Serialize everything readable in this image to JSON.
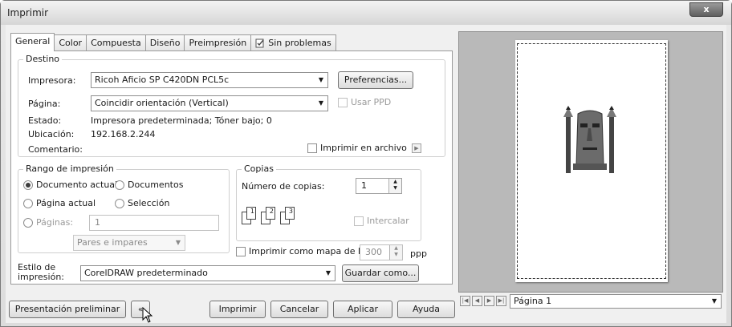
{
  "window": {
    "title": "Imprimir",
    "close_label": "x"
  },
  "tabs": [
    {
      "label": "General",
      "active": true
    },
    {
      "label": "Color"
    },
    {
      "label": "Compuesta"
    },
    {
      "label": "Diseño"
    },
    {
      "label": "Preimpresión"
    },
    {
      "label": "Sin problemas",
      "icon": "check-document-icon"
    }
  ],
  "destino": {
    "title": "Destino",
    "printer_label": "Impresora:",
    "printer_value": "Ricoh Aficio SP C420DN PCL5c",
    "preferences_button": "Preferencias...",
    "page_label": "Página:",
    "page_value": "Coincidir orientación (Vertical)",
    "use_ppd_label": "Usar PPD",
    "status_label": "Estado:",
    "status_value": "Impresora predeterminada; Tóner bajo; 0",
    "location_label": "Ubicación:",
    "location_value": "192.168.2.244",
    "comment_label": "Comentario:",
    "print_to_file_label": "Imprimir en archivo"
  },
  "range": {
    "title": "Rango de impresión",
    "current_document": "Documento actual",
    "documents": "Documentos",
    "current_page": "Página actual",
    "selection": "Selección",
    "pages_label": "Páginas:",
    "pages_value": "1",
    "parity_value": "Pares e impares"
  },
  "copies": {
    "title": "Copias",
    "count_label": "Número de copias:",
    "count_value": "1",
    "collate_label": "Intercalar",
    "icon_numbers": [
      "1",
      "1",
      "2",
      "2",
      "3",
      "3"
    ]
  },
  "bitmap": {
    "label": "Imprimir como mapa de bits:",
    "value": "300",
    "unit": "ppp"
  },
  "style": {
    "label_line1": "Estilo de",
    "label_line2": "impresión:",
    "value": "CorelDRAW predeterminado",
    "save_as_button": "Guardar como..."
  },
  "footer": {
    "preview_button": "Presentación preliminar",
    "print_button": "Imprimir",
    "cancel_button": "Cancelar",
    "apply_button": "Aplicar",
    "help_button": "Ayuda"
  },
  "preview": {
    "page_selector": "Página 1"
  }
}
